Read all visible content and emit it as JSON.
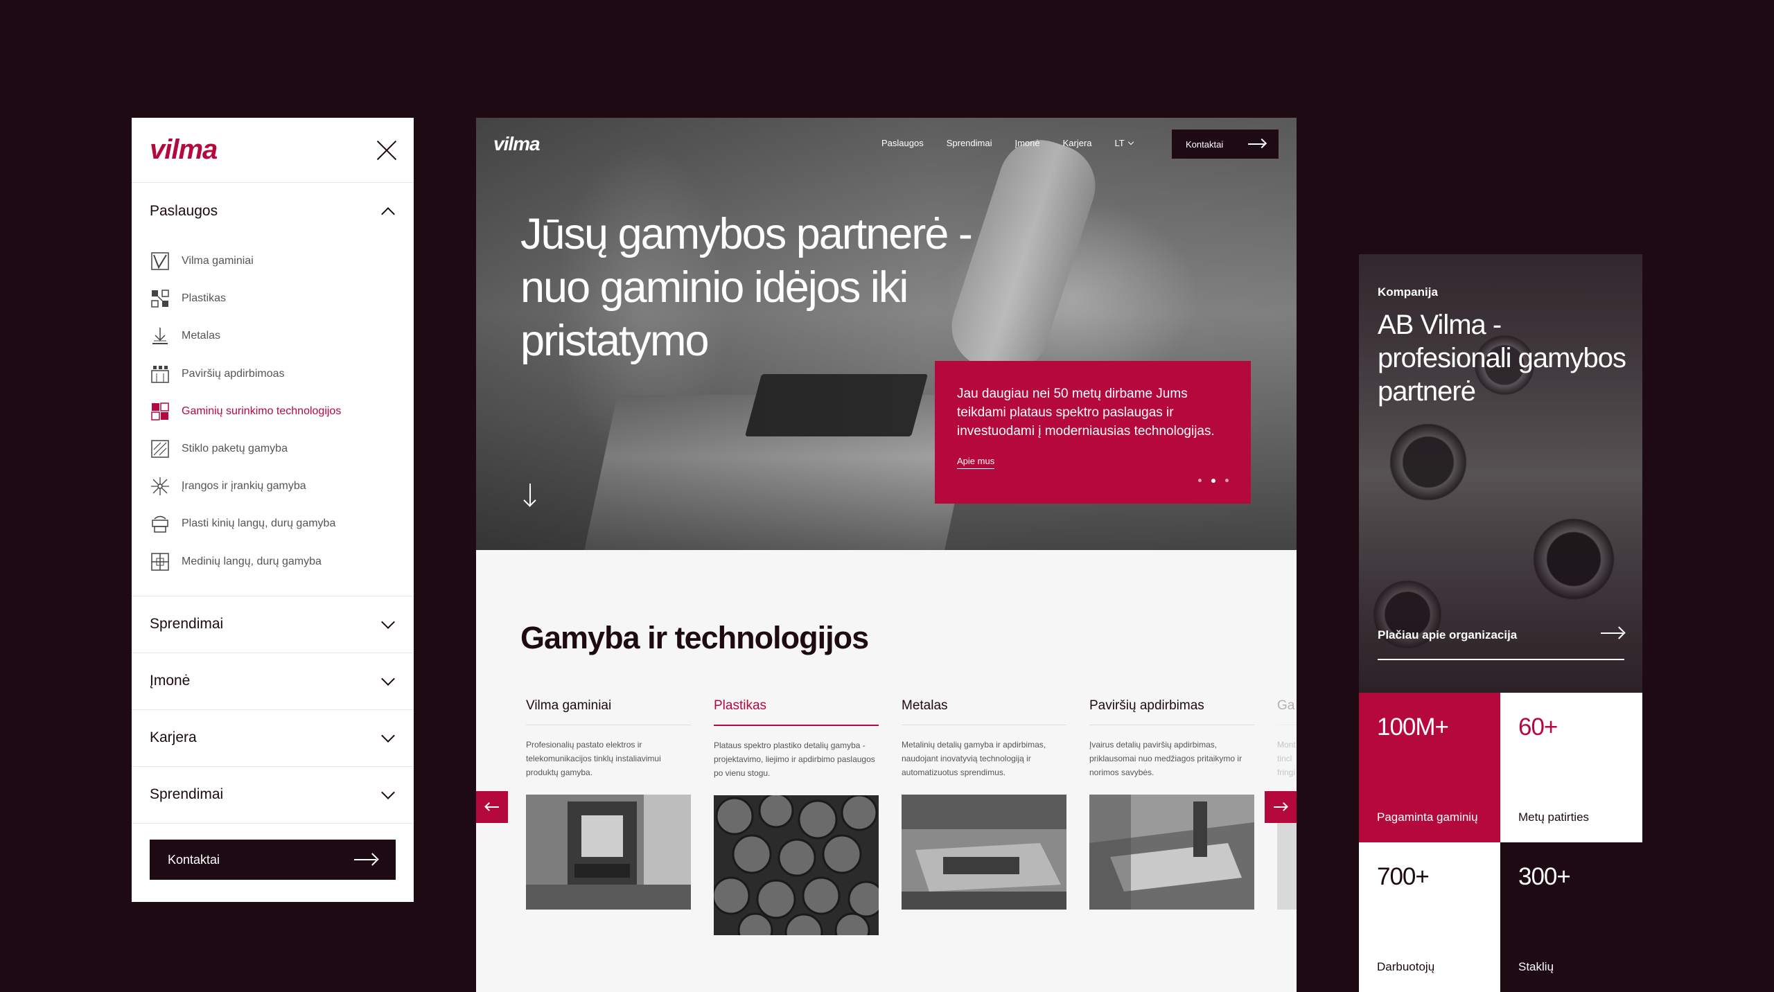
{
  "brand": {
    "logo": "vilma",
    "accent": "#b5093e",
    "dark": "#1d0a13"
  },
  "mobile_menu": {
    "sections": [
      {
        "label": "Paslaugos",
        "open": true
      },
      {
        "label": "Sprendimai",
        "open": false
      },
      {
        "label": "Įmonė",
        "open": false
      },
      {
        "label": "Karjera",
        "open": false
      },
      {
        "label": "Sprendimai",
        "open": false
      }
    ],
    "sub_items": [
      {
        "label": "Vilma gaminiai",
        "icon": "v-logo-icon"
      },
      {
        "label": "Plastikas",
        "icon": "plastic-icon"
      },
      {
        "label": "Metalas",
        "icon": "metal-icon"
      },
      {
        "label": "Paviršių apdirbimoas",
        "icon": "surface-icon"
      },
      {
        "label": "Gaminių surinkimo technologijos",
        "icon": "assembly-icon",
        "active": true
      },
      {
        "label": "Stiklo paketų gamyba",
        "icon": "glass-icon"
      },
      {
        "label": "Įrangos ir įrankių gamyba",
        "icon": "tools-icon"
      },
      {
        "label": "Plasti kinių langų, durų gamyba",
        "icon": "plastic-window-icon"
      },
      {
        "label": "Medinių langų, durų gamyba",
        "icon": "wooden-window-icon"
      }
    ],
    "cta": "Kontaktai"
  },
  "desktop": {
    "nav": {
      "links": [
        "Paslaugos",
        "Sprendimai",
        "Įmonė",
        "Karjera"
      ],
      "lang": "LT",
      "cta": "Kontaktai"
    },
    "hero": {
      "title": "Jūsų gamybos partnerė - nuo gaminio idėjos iki pristatymo",
      "card_text": "Jau daugiau nei 50 metų dirbame Jums teikdami plataus spektro paslaugas ir investuodami į moderniausias technologijas.",
      "card_link": "Apie mus",
      "slides": 3,
      "active_slide": 2
    },
    "section_title": "Gamyba ir technologijos",
    "cards": [
      {
        "title": "Vilma gaminiai",
        "desc": "Profesionalių pastato elektros ir telekomunikacijos tinklų instaliavimui produktų gamyba."
      },
      {
        "title": "Plastikas",
        "desc": "Plataus spektro plastiko detalių gamyba - projektavimo, liejimo ir apdirbimo paslaugos po vienu stogu.",
        "active": true
      },
      {
        "title": "Metalas",
        "desc": "Metalinių detalių gamyba ir apdirbimas, naudojant inovatyvią technologiją ir automatizuotus sprendimus."
      },
      {
        "title": "Paviršių apdirbimas",
        "desc": "Įvairus detalių paviršių apdirbimas, priklausomai nuo medžiagos pritaikymo ir norimos savybės."
      },
      {
        "title": "Ga",
        "desc": "Mont tincl fringi"
      }
    ]
  },
  "company": {
    "eyebrow": "Kompanija",
    "title": "AB Vilma - profesionali gamybos partnerė",
    "link": "Plačiau apie organizacija",
    "stats": [
      {
        "num": "100M+",
        "label": "Pagaminta gaminių"
      },
      {
        "num": "60+",
        "label": "Metų patirties"
      },
      {
        "num": "700+",
        "label": "Darbuotojų"
      },
      {
        "num": "300+",
        "label": "Staklių"
      }
    ]
  }
}
